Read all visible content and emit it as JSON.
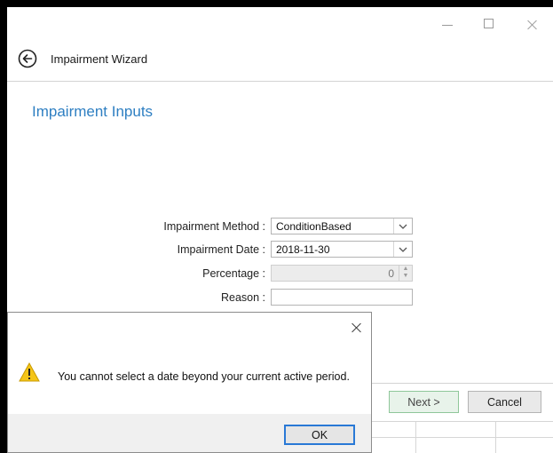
{
  "window": {
    "title": "Impairment Wizard"
  },
  "page": {
    "section_title": "Impairment Inputs"
  },
  "form": {
    "method_label": "Impairment Method :",
    "method_value": "ConditionBased",
    "date_label": "Impairment Date :",
    "date_value": "2018-11-30",
    "percentage_label": "Percentage :",
    "percentage_value": "0",
    "reason_label": "Reason :",
    "reason_value": ""
  },
  "footer": {
    "next_label": "Next >",
    "cancel_label": "Cancel"
  },
  "dialog": {
    "message": "You cannot select a date beyond your current active period.",
    "ok_label": "OK"
  },
  "colors": {
    "accent": "#2e7fc2",
    "warning": "#f5c518",
    "next_button_border": "#8fc79a"
  },
  "icons": [
    "back-arrow-icon",
    "minimize-icon",
    "maximize-icon",
    "close-icon",
    "chevron-down-icon",
    "warning-icon"
  ]
}
